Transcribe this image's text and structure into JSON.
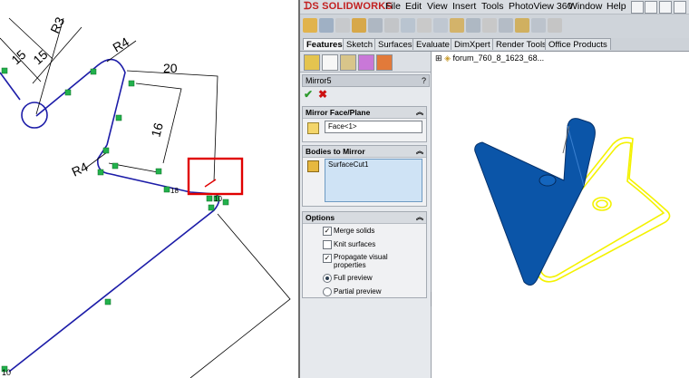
{
  "sketch": {
    "dims": [
      "15",
      "15",
      "R3",
      "R4",
      "20",
      "16",
      "R4",
      "10"
    ],
    "small_tags": [
      "18",
      "10"
    ]
  },
  "app": {
    "brand": "SOLIDWORKS",
    "menus": [
      "File",
      "Edit",
      "View",
      "Insert",
      "Tools",
      "PhotoView 360",
      "Window",
      "Help"
    ]
  },
  "cm_tabs": [
    "Features",
    "Sketch",
    "Surfaces",
    "Evaluate",
    "DimXpert",
    "Render Tools",
    "Office Products"
  ],
  "property_manager": {
    "feature_title": "Mirror5",
    "help": "?",
    "sections": {
      "mirror_face": {
        "title": "Mirror Face/Plane",
        "value": "Face<1>"
      },
      "bodies": {
        "title": "Bodies to Mirror",
        "value": "SurfaceCut1"
      },
      "options": {
        "title": "Options",
        "merge_solids": "Merge solids",
        "knit_surfaces": "Knit surfaces",
        "propagate_1": "Propagate visual",
        "propagate_2": "properties",
        "full_preview": "Full preview",
        "partial_preview": "Partial preview"
      }
    }
  },
  "tree": {
    "root": "forum_760_8_1623_68..."
  },
  "colors": {
    "body_blue": "#0b55a8",
    "preview_yellow": "#f4f200",
    "sketch_blue": "#1c1ca8",
    "highlight_red": "#e00000"
  }
}
